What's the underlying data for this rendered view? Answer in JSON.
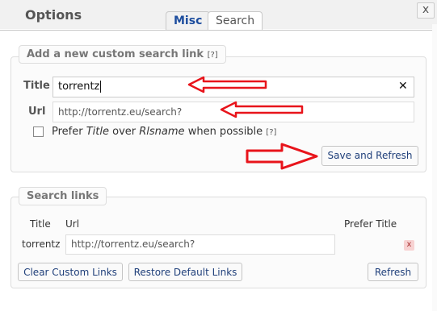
{
  "dialog": {
    "title": "Options",
    "close_label": "x"
  },
  "tabs": [
    {
      "label": "Misc"
    },
    {
      "label": "Search"
    }
  ],
  "custom_link": {
    "legend": "Add a new custom search link",
    "legend_help": "[?]",
    "title_label": "Title",
    "title_value": "torrentz",
    "clear_label": "✕",
    "url_label": "Url",
    "url_placeholder": "http://torrentz.eu/search?",
    "prefer_label_a": "Prefer ",
    "prefer_label_title": "Title",
    "prefer_label_b": " over ",
    "prefer_label_rls": "Rlsname",
    "prefer_label_c": " when possible ",
    "prefer_help": "[?]",
    "save_button": "Save and Refresh"
  },
  "search_links": {
    "legend": "Search links",
    "columns": [
      "Title",
      "Url",
      "Prefer Title"
    ],
    "rows": [
      {
        "title": "torrentz",
        "url": "http://torrentz.eu/search?",
        "remove": "x"
      }
    ],
    "clear_button": "Clear Custom Links",
    "restore_button": "Restore Default Links",
    "refresh_button": "Refresh"
  },
  "colors": {
    "annotation_arrow": "#e8141b",
    "link_blue": "#1f3f7a"
  }
}
